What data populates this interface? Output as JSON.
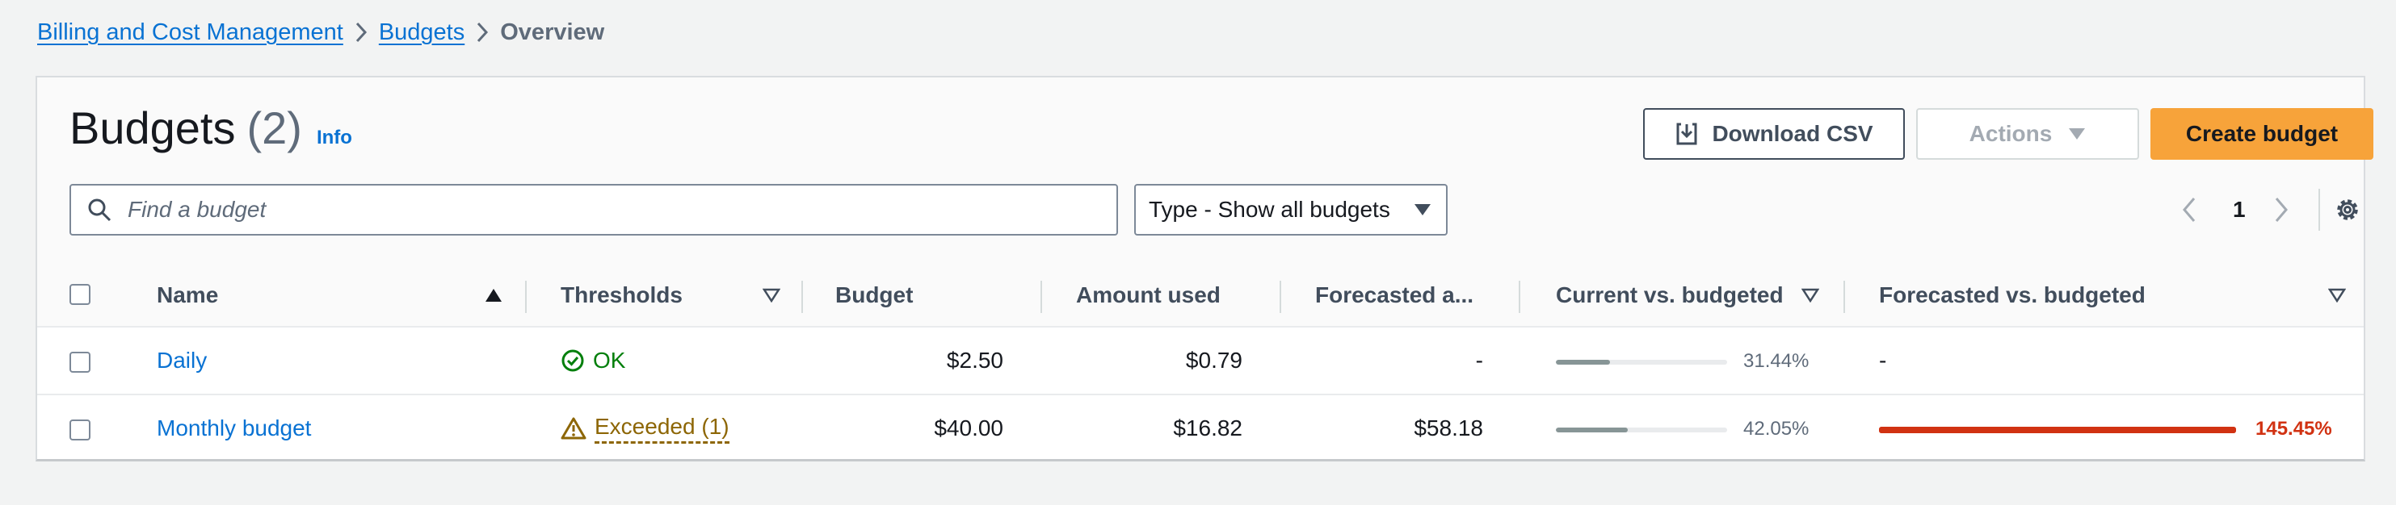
{
  "breadcrumb": {
    "items": [
      "Billing and Cost Management",
      "Budgets"
    ],
    "current": "Overview"
  },
  "header": {
    "title": "Budgets",
    "count": "(2)",
    "info": "Info"
  },
  "toolbar": {
    "download_label": "Download CSV",
    "actions_label": "Actions",
    "create_label": "Create budget"
  },
  "search": {
    "placeholder": "Find a budget",
    "value": ""
  },
  "filter": {
    "selected": "Type - Show all budgets"
  },
  "pagination": {
    "page": "1"
  },
  "table": {
    "columns": [
      "Name",
      "Thresholds",
      "Budget",
      "Amount used",
      "Forecasted a...",
      "Current vs. budgeted",
      "Forecasted vs. budgeted"
    ],
    "rows": [
      {
        "name": "Daily",
        "threshold": "OK",
        "threshold_status": "ok",
        "budget": "$2.50",
        "used": "$0.79",
        "forecasted": "-",
        "current_pct": "31.44%",
        "current_fraction": 0.3144,
        "forecast_pct": "-",
        "forecast_fraction": null
      },
      {
        "name": "Monthly budget",
        "threshold": "Exceeded (1)",
        "threshold_status": "exceeded",
        "budget": "$40.00",
        "used": "$16.82",
        "forecasted": "$58.18",
        "current_pct": "42.05%",
        "current_fraction": 0.4205,
        "forecast_pct": "145.45%",
        "forecast_fraction": 1.4545
      }
    ]
  },
  "colors": {
    "link": "#0972d3",
    "primary_button": "#f7a33a",
    "ok": "#037f0c",
    "warning": "#8d6605",
    "error": "#d13212",
    "progress": "#879596"
  }
}
